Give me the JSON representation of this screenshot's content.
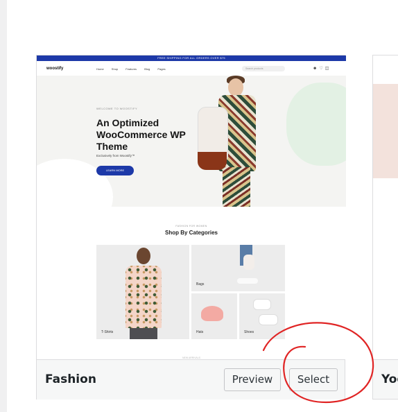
{
  "card": {
    "theme_name": "Fashion",
    "preview_button": "Preview",
    "select_button": "Select"
  },
  "preview": {
    "topbar_text": "FREE SHIPPING FOR ALL ORDERS OVER $75",
    "logo": "woostify",
    "nav": [
      "Home",
      "Shop",
      "Features",
      "Blog",
      "Pages"
    ],
    "search_placeholder": "Search products",
    "hero": {
      "kicker": "WELCOME TO WOOSTIFY",
      "title": "An Optimized WooCommerce WP Theme",
      "subtitle": "Exclusively from Woostify™",
      "cta": "LEARN MORE"
    },
    "categories": {
      "kicker": "FASHION FOR WOMEN",
      "title": "Shop By Categories",
      "tiles": [
        "T-Shirts",
        "Bags",
        "Hats",
        "Shoes"
      ]
    },
    "faint_text": "NEW ARRIVALS"
  },
  "next_card": {
    "theme_name_partial": "Yog"
  },
  "colors": {
    "accent_blue": "#1d39a8",
    "annotation_red": "#e02424",
    "footer_bg": "#f6f7f7"
  }
}
